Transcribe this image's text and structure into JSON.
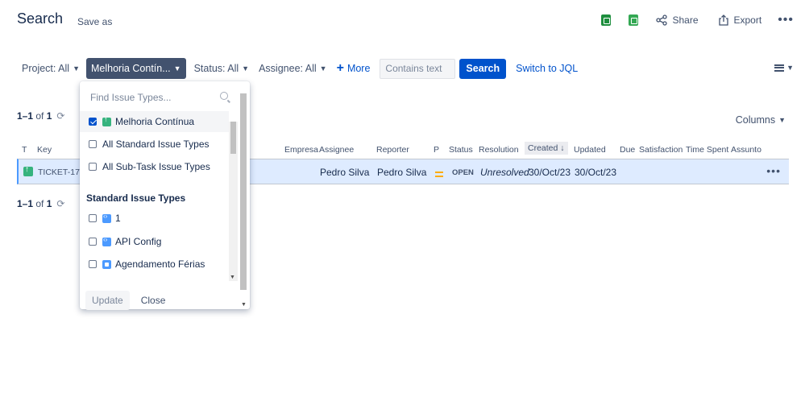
{
  "header": {
    "title": "Search",
    "save_as": "Save as",
    "share": "Share",
    "export": "Export",
    "more_icon": "more-dots-icon"
  },
  "filters": {
    "project": "Project: All",
    "issue_type": "Melhoria Contín...",
    "status": "Status: All",
    "assignee": "Assignee: All",
    "more": "More",
    "contains_placeholder": "Contains text",
    "search_button": "Search",
    "switch_jql": "Switch to JQL"
  },
  "results": {
    "count_top": "1–1",
    "of_label": "of",
    "total": "1",
    "count_bottom": "1–1",
    "columns_button": "Columns",
    "headers": {
      "t": "T",
      "key": "Key",
      "empresa": "Empresa",
      "assignee": "Assignee",
      "reporter": "Reporter",
      "p": "P",
      "status": "Status",
      "resolution": "Resolution",
      "created": "Created",
      "updated": "Updated",
      "due": "Due",
      "satisfaction": "Satisfaction",
      "time_spent": "Time Spent",
      "assunto": "Assunto"
    },
    "rows": [
      {
        "key": "TICKET-1719",
        "assignee": "Pedro Silva",
        "reporter": "Pedro Silva",
        "status": "OPEN",
        "resolution": "Unresolved",
        "created": "30/Oct/23",
        "updated": "30/Oct/23"
      }
    ]
  },
  "dropdown": {
    "find_placeholder": "Find Issue Types...",
    "options": [
      {
        "label": "Melhoria Contínua",
        "checked": true
      },
      {
        "label": "All Standard Issue Types",
        "checked": false
      },
      {
        "label": "All Sub-Task Issue Types",
        "checked": false
      }
    ],
    "group_label": "Standard Issue Types",
    "standard_items": [
      {
        "label": "1",
        "checked": false
      },
      {
        "label": "API Config",
        "checked": false
      },
      {
        "label": "Agendamento Férias",
        "checked": false
      }
    ],
    "update_button": "Update",
    "close_button": "Close"
  },
  "colors": {
    "brand": "#0052cc",
    "row_highlight": "#deebff",
    "active_filter": "#42526e",
    "type_green": "#36b37e",
    "priority_medium": "#ffab00"
  }
}
